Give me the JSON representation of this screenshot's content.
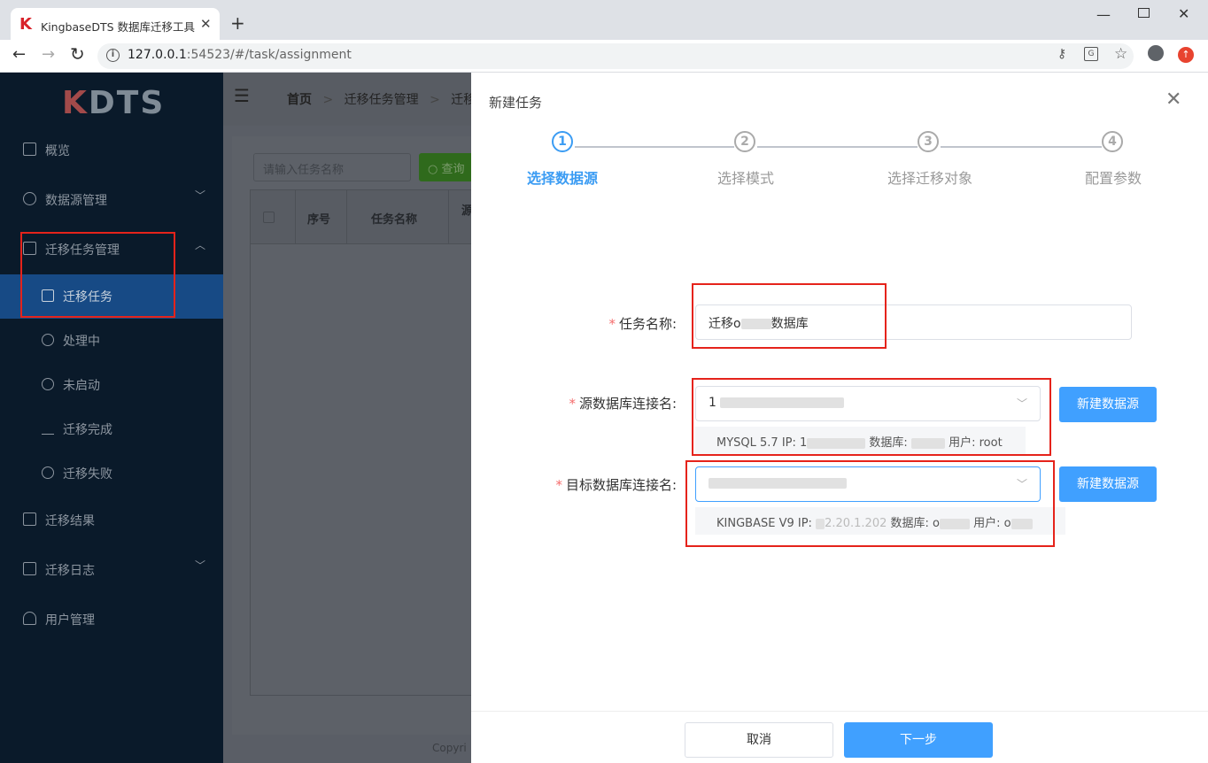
{
  "browser": {
    "tab_title": "KingbaseDTS 数据库迁移工具",
    "tab_logo": "K",
    "tab_close": "✕",
    "new_tab": "+",
    "url_host": "127.0.0.1",
    "url_rest": ":54523/#/task/assignment",
    "window_min": "—",
    "window_close": "✕"
  },
  "sidebar": {
    "logo_k": "K",
    "logo_rest": "DTS",
    "items": [
      {
        "label": "概览",
        "icon": "grid-icon"
      },
      {
        "label": "数据源管理",
        "icon": "database-icon",
        "arrow": "﹀"
      },
      {
        "label": "迁移任务管理",
        "icon": "folder-icon",
        "arrow": "︿"
      },
      {
        "label": "迁移结果",
        "icon": "folder-check-icon"
      },
      {
        "label": "迁移日志",
        "icon": "document-icon",
        "arrow": "﹀"
      },
      {
        "label": "用户管理",
        "icon": "user-icon"
      }
    ],
    "sub_items": [
      {
        "label": "迁移任务",
        "icon": "book-icon"
      },
      {
        "label": "处理中",
        "icon": "timer-icon"
      },
      {
        "label": "未启动",
        "icon": "play-icon"
      },
      {
        "label": "迁移完成",
        "icon": "checklist-icon"
      },
      {
        "label": "迁移失败",
        "icon": "x-circle-icon"
      }
    ]
  },
  "header": {
    "hamburger": "☰",
    "breadcrumb": [
      "首页",
      "迁移任务管理",
      "迁移任"
    ]
  },
  "content": {
    "search_placeholder": "请输入任务名称",
    "search_button": "查询",
    "columns": [
      "序号",
      "任务名称",
      "源"
    ],
    "copyright": "Copyri"
  },
  "drawer": {
    "title": "新建任务",
    "close": "✕",
    "steps": [
      {
        "num": "1",
        "label": "选择数据源"
      },
      {
        "num": "2",
        "label": "选择模式"
      },
      {
        "num": "3",
        "label": "选择迁移对象"
      },
      {
        "num": "4",
        "label": "配置参数"
      }
    ],
    "task_name_label": "任务名称:",
    "task_name_value_prefix": "迁移o",
    "task_name_value_suffix": "数据库",
    "source_label": "源数据库连接名:",
    "source_value_prefix": "1",
    "source_hint_prefix": "MYSQL 5.7 IP: 1",
    "source_hint_db": "数据库:",
    "source_hint_user": "用户: root",
    "target_label": "目标数据库连接名:",
    "target_hint_prefix": "KINGBASE V9 IP: ",
    "target_hint_ip_tail": "2.20.1.202",
    "target_hint_db": "数据库: o",
    "target_hint_user": "用户: o",
    "new_source_button": "新建数据源",
    "required_mark": "*",
    "select_chevron": "﹀",
    "cancel_button": "取消",
    "next_button": "下一步"
  },
  "colors": {
    "accent": "#40a0ff",
    "highlight_box": "#e5231b",
    "sidebar_bg": "#0a1a2a",
    "active_menu": "#174a85"
  }
}
